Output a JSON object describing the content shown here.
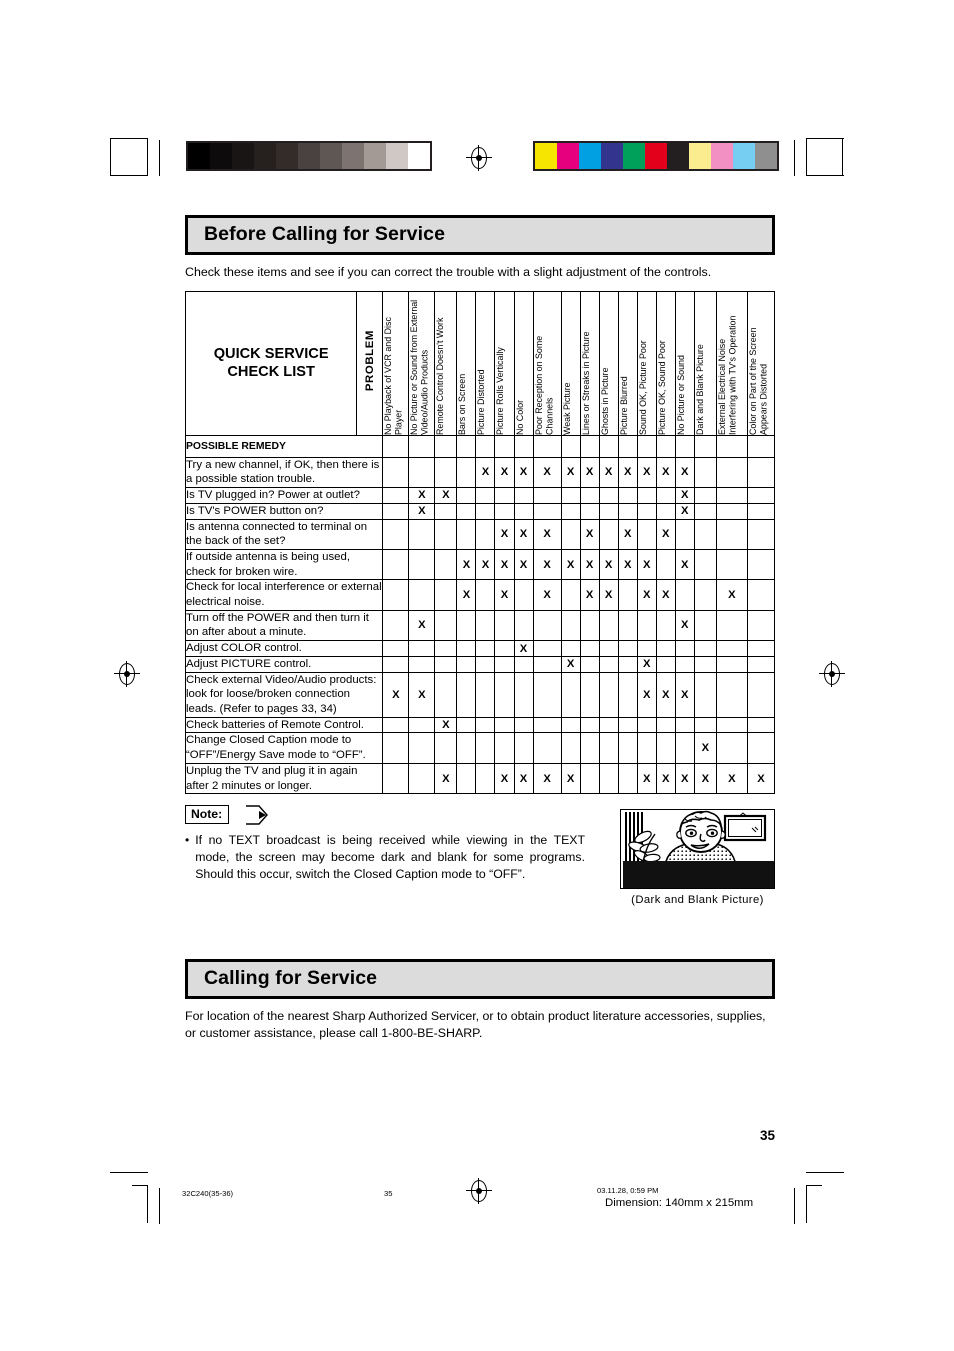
{
  "sections": {
    "before": {
      "title": "Before Calling for Service",
      "intro": "Check these items and see if you can correct the trouble with a slight adjustment of the controls."
    },
    "calling": {
      "title": "Calling for Service",
      "body": "For location of the nearest Sharp Authorized Servicer, or to obtain product literature accessories, supplies, or customer assistance, please call 1-800-BE-SHARP."
    }
  },
  "table": {
    "corner_title": "QUICK SERVICE\nCHECK LIST",
    "corner_title_line1": "QUICK SERVICE",
    "corner_title_line2": "CHECK LIST",
    "problem_label": "PROBLEM",
    "possible_remedy_label": "POSSIBLE REMEDY",
    "columns": [
      "No Playback of VCR and Disc Player",
      "No Picture or Sound from External Video/Audio Products",
      "Remote Control Doesn't Work",
      "Bars on Screen",
      "Picture Distorted",
      "Picture Rolls Vertically",
      "No Color",
      "Poor Reception on Some Channels",
      "Weak  Picture",
      "Lines or Streaks in Picture",
      "Ghosts in Picture",
      "Picture Blurred",
      "Sound OK, Picture Poor",
      "Picture OK, Sound Poor",
      "No Picture or Sound",
      "Dark and Blank Picture",
      "External Electrical Noise Interfering with TV's Operation",
      "Color on Part of the Screen Appears Distorted"
    ],
    "mark": "X",
    "rows": [
      {
        "remedy": "Try a new channel, if OK, then there is a possible station trouble.",
        "marks": [
          0,
          0,
          0,
          0,
          1,
          1,
          1,
          1,
          1,
          1,
          1,
          1,
          1,
          1,
          1,
          0,
          0,
          0
        ]
      },
      {
        "remedy": "Is TV plugged in? Power at outlet?",
        "marks": [
          0,
          1,
          1,
          0,
          0,
          0,
          0,
          0,
          0,
          0,
          0,
          0,
          0,
          0,
          1,
          0,
          0,
          0
        ]
      },
      {
        "remedy": "Is TV's POWER button on?",
        "marks": [
          0,
          1,
          0,
          0,
          0,
          0,
          0,
          0,
          0,
          0,
          0,
          0,
          0,
          0,
          1,
          0,
          0,
          0
        ]
      },
      {
        "remedy": "Is antenna connected to terminal on the back of the set?",
        "marks": [
          0,
          0,
          0,
          0,
          0,
          1,
          1,
          1,
          0,
          1,
          0,
          1,
          0,
          1,
          0,
          0,
          0,
          0
        ]
      },
      {
        "remedy": "If outside antenna is being used, check for broken wire.",
        "marks": [
          0,
          0,
          0,
          1,
          1,
          1,
          1,
          1,
          1,
          1,
          1,
          1,
          1,
          0,
          1,
          0,
          0,
          0
        ]
      },
      {
        "remedy": "Check for local interference or external electrical noise.",
        "marks": [
          0,
          0,
          0,
          1,
          0,
          1,
          0,
          1,
          0,
          1,
          1,
          0,
          1,
          1,
          0,
          0,
          1,
          0
        ]
      },
      {
        "remedy": "Turn off the POWER and then turn it on after about a minute.",
        "marks": [
          0,
          1,
          0,
          0,
          0,
          0,
          0,
          0,
          0,
          0,
          0,
          0,
          0,
          0,
          1,
          0,
          0,
          0
        ]
      },
      {
        "remedy": "Adjust COLOR control.",
        "marks": [
          0,
          0,
          0,
          0,
          0,
          0,
          1,
          0,
          0,
          0,
          0,
          0,
          0,
          0,
          0,
          0,
          0,
          0
        ]
      },
      {
        "remedy": "Adjust PICTURE control.",
        "marks": [
          0,
          0,
          0,
          0,
          0,
          0,
          0,
          0,
          1,
          0,
          0,
          0,
          1,
          0,
          0,
          0,
          0,
          0
        ]
      },
      {
        "remedy": "Check external Video/Audio products: look for loose/broken connection leads. (Refer to pages 33, 34)",
        "marks": [
          1,
          1,
          0,
          0,
          0,
          0,
          0,
          0,
          0,
          0,
          0,
          0,
          1,
          1,
          1,
          0,
          0,
          0
        ]
      },
      {
        "remedy": "Check batteries of Remote Control.",
        "marks": [
          0,
          0,
          1,
          0,
          0,
          0,
          0,
          0,
          0,
          0,
          0,
          0,
          0,
          0,
          0,
          0,
          0,
          0
        ]
      },
      {
        "remedy": "Change Closed Caption mode to “OFF”/Energy Save mode to “OFF”.",
        "marks": [
          0,
          0,
          0,
          0,
          0,
          0,
          0,
          0,
          0,
          0,
          0,
          0,
          0,
          0,
          0,
          1,
          0,
          0
        ]
      },
      {
        "remedy": "Unplug the TV and plug it in again after 2 minutes or longer.",
        "marks": [
          0,
          0,
          1,
          0,
          0,
          1,
          1,
          1,
          1,
          0,
          0,
          0,
          1,
          1,
          1,
          1,
          1,
          1
        ]
      }
    ]
  },
  "note": {
    "tag": "Note:",
    "bullet": "•",
    "text": "If no TEXT broadcast is being received while viewing in the TEXT mode, the screen may become dark and blank for some programs. Should this occur, switch the Closed Caption mode to “OFF”."
  },
  "illustration": {
    "caption": "(Dark and Blank Picture)"
  },
  "page_number": "35",
  "footer": {
    "job": "32C240(35-36)",
    "page": "35",
    "timestamp": "03.11.28, 0:59 PM",
    "dimension": "Dimension: 140mm x 215mm"
  },
  "colorbars": {
    "gray_ramp": [
      "#000000",
      "#0d0b0b",
      "#181514",
      "#26211f",
      "#332c29",
      "#4a4240",
      "#5f5754",
      "#7d7471",
      "#a39a96",
      "#cfc8c4",
      "#ffffff"
    ],
    "color_patches": [
      "#f6e500",
      "#e6007e",
      "#00a0e3",
      "#33348e",
      "#00a05a",
      "#e3001b",
      "#231f20",
      "#faec8f",
      "#f28fc3",
      "#76cff2",
      "#8f8f8f"
    ],
    "frame": "#231f20"
  }
}
